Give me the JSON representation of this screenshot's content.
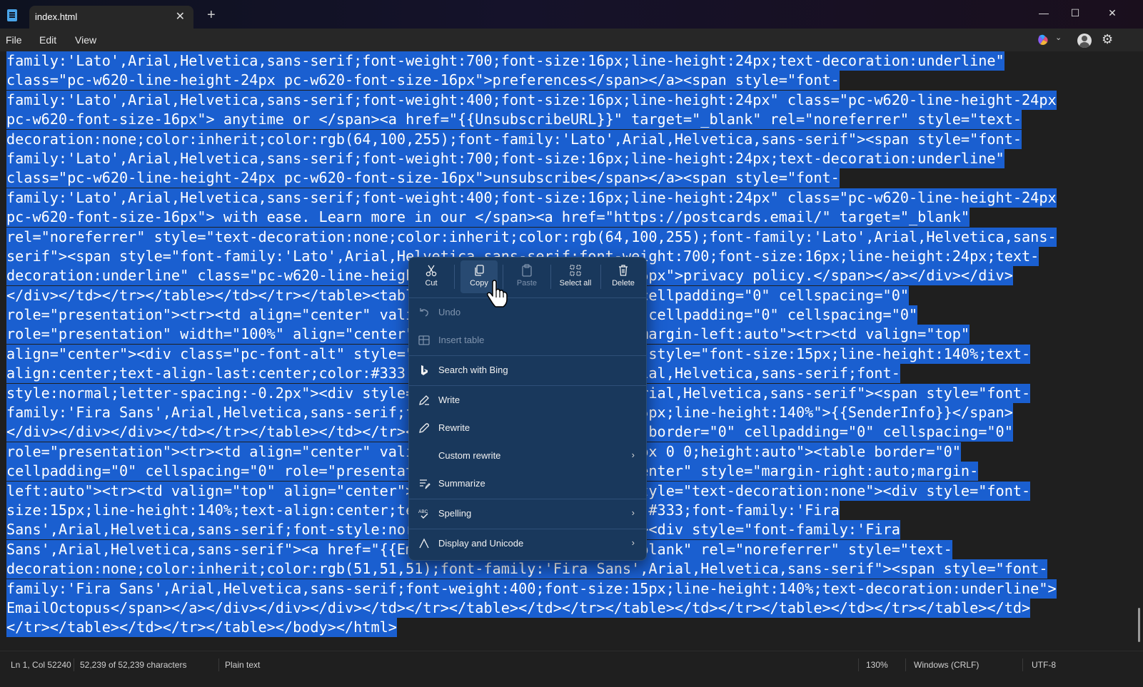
{
  "titlebar": {
    "tab_title": "index.html",
    "tab_close": "✕",
    "new_tab": "+",
    "minimize": "—",
    "maximize": "☐",
    "close": "✕"
  },
  "menubar": {
    "items": [
      "File",
      "Edit",
      "View"
    ]
  },
  "editor": {
    "lines": [
      "family:'Lato',Arial,Helvetica,sans-serif;font-weight:700;font-size:16px;line-height:24px;text-decoration:underline\"",
      "class=\"pc-w620-line-height-24px pc-w620-font-size-16px\">preferences</span></a><span style=\"font-",
      "family:'Lato',Arial,Helvetica,sans-serif;font-weight:400;font-size:16px;line-height:24px\" class=\"pc-w620-line-height-24px",
      "pc-w620-font-size-16px\"> anytime or </span><a href=\"{{UnsubscribeURL}}\" target=\"_blank\" rel=\"noreferrer\" style=\"text-",
      "decoration:none;color:inherit;color:rgb(64,100,255);font-family:'Lato',Arial,Helvetica,sans-serif\"><span style=\"font-",
      "family:'Lato',Arial,Helvetica,sans-serif;font-weight:700;font-size:16px;line-height:24px;text-decoration:underline\"",
      "class=\"pc-w620-line-height-24px pc-w620-font-size-16px\">unsubscribe</span></a><span style=\"font-",
      "family:'Lato',Arial,Helvetica,sans-serif;font-weight:400;font-size:16px;line-height:24px\" class=\"pc-w620-line-height-24px",
      "pc-w620-font-size-16px\"> with ease. Learn more in our </span><a href=\"https://postcards.email/\" target=\"_blank\"",
      "rel=\"noreferrer\" style=\"text-decoration:none;color:inherit;color:rgb(64,100,255);font-family:'Lato',Arial,Helvetica,sans-",
      "serif\"><span style=\"font-family:'Lato',Arial,Helvetica,sans-serif;font-weight:700;font-size:16px;line-height:24px;text-",
      "decoration:underline\" class=\"pc-w620-line-height-24px pc-w620-font-size-16px\">privacy policy.</span></a></div></div>",
      "</div></td></tr></table></td></tr></table><table width=\"100%\" border=\"0\" cellpadding=\"0\" cellspacing=\"0\"",
      "role=\"presentation\"><tr><td align=\"center\" valign=\"top\"><table border=\"0\" cellpadding=\"0\" cellspacing=\"0\"",
      "role=\"presentation\" width=\"100%\" align=\"center\" style=\"margin-right:auto;margin-left:auto\"><tr><td valign=\"top\"",
      "align=\"center\"><div class=\"pc-font-alt\" style=\"text-decoration:none\"><div style=\"font-size:15px;line-height:140%;text-",
      "align:center;text-align-last:center;color:#333;font-family:'Fira Sans',Arial,Helvetica,sans-serif;font-",
      "style:normal;letter-spacing:-0.2px\"><div style=\"font-family:'Fira Sans',Arial,Helvetica,sans-serif\"><span style=\"font-",
      "family:'Fira Sans',Arial,Helvetica,sans-serif;font-weight:400;font-size:15px;line-height:140%\">{{SenderInfo}}</span>",
      "</div></div></div></td></tr></table></td></tr></table><table width=\"100%\" border=\"0\" cellpadding=\"0\" cellspacing=\"0\"",
      "role=\"presentation\"><tr><td align=\"center\" valign=\"top\" style=\"padding:26px 0 0;height:auto\"><table border=\"0\"",
      "cellpadding=\"0\" cellspacing=\"0\" role=\"presentation\" width=\"100%\" align=\"center\" style=\"margin-right:auto;margin-",
      "left:auto\"><tr><td valign=\"top\" align=\"center\"><div class=\"pc-font-alt\" style=\"text-decoration:none\"><div style=\"font-",
      "size:15px;line-height:140%;text-align:center;text-align-last:center;color:#333;font-family:'Fira",
      "Sans',Arial,Helvetica,sans-serif;font-style:normal;letter-spacing:-0.2px\"><div style=\"font-family:'Fira",
      "Sans',Arial,Helvetica,sans-serif\"><a href=\"{{EmailOctopusURL}}\" target=\"_blank\" rel=\"noreferrer\" style=\"text-",
      "decoration:none;color:inherit;color:rgb(51,51,51);font-family:'Fira Sans',Arial,Helvetica,sans-serif\"><span style=\"font-",
      "family:'Fira Sans',Arial,Helvetica,sans-serif;font-weight:400;font-size:15px;line-height:140%;text-decoration:underline\">",
      "EmailOctopus</span></a></div></div></div></td></tr></table></td></tr></table></td></tr></table></td></tr></table></td>",
      "</tr></table></td></tr></table></body></html>"
    ]
  },
  "context_menu": {
    "toolbar": [
      {
        "label": "Cut",
        "icon": "scissors-icon",
        "enabled": true
      },
      {
        "label": "Copy",
        "icon": "copy-icon",
        "enabled": true
      },
      {
        "label": "Paste",
        "icon": "clipboard-icon",
        "enabled": false
      },
      {
        "label": "Select all",
        "icon": "select-all-icon",
        "enabled": true
      },
      {
        "label": "Delete",
        "icon": "trash-icon",
        "enabled": true
      }
    ],
    "items": {
      "undo": "Undo",
      "insert_table": "Insert table",
      "search_bing": "Search with Bing",
      "write": "Write",
      "rewrite": "Rewrite",
      "custom_rewrite": "Custom rewrite",
      "summarize": "Summarize",
      "spelling": "Spelling",
      "display_unicode": "Display and Unicode",
      "chevron": "›"
    }
  },
  "statusbar": {
    "position": "Ln 1, Col 52240",
    "characters": "52,239 of 52,239 characters",
    "format": "Plain text",
    "zoom": "130%",
    "line_endings": "Windows (CRLF)",
    "encoding": "UTF-8"
  },
  "colors": {
    "selection": "#1a5fd0",
    "menu_bg": "#19385c",
    "editor_bg": "#1f1f1f"
  }
}
